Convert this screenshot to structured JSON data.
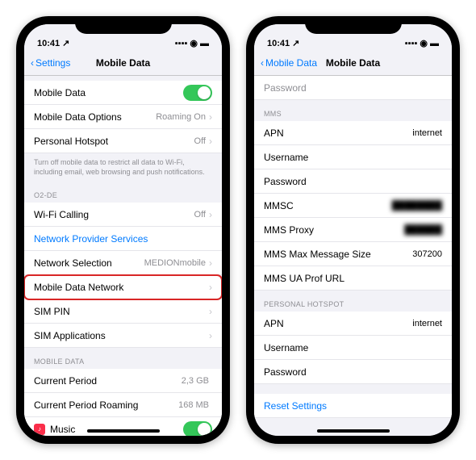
{
  "status": {
    "time": "10:41",
    "loc": "↗"
  },
  "left": {
    "back": "Settings",
    "title": "Mobile Data",
    "cells": {
      "mobile_data": "Mobile Data",
      "options": "Mobile Data Options",
      "options_val": "Roaming On",
      "hotspot": "Personal Hotspot",
      "hotspot_val": "Off",
      "help": "Turn off mobile data to restrict all data to Wi-Fi, including email, web browsing and push notifications.",
      "carrier_group": "O2-DE",
      "wifi_calling": "Wi-Fi Calling",
      "wifi_calling_val": "Off",
      "provider_services": "Network Provider Services",
      "network_selection": "Network Selection",
      "network_selection_val": "MEDIONmobile",
      "mobile_data_network": "Mobile Data Network",
      "sim_pin": "SIM PIN",
      "sim_apps": "SIM Applications",
      "md_group": "MOBILE DATA",
      "current_period": "Current Period",
      "current_period_val": "2,3 GB",
      "roaming": "Current Period Roaming",
      "roaming_val": "168 MB",
      "music": "Music"
    }
  },
  "right": {
    "back": "Mobile Data",
    "title": "Mobile Data",
    "password_partial": "Password",
    "mms_group": "MMS",
    "apn": "APN",
    "apn_val": "internet",
    "username": "Username",
    "password": "Password",
    "mmsc": "MMSC",
    "mms_proxy": "MMS Proxy",
    "mms_max": "MMS Max Message Size",
    "mms_max_val": "307200",
    "mms_ua": "MMS UA Prof URL",
    "ph_group": "PERSONAL HOTSPOT",
    "reset": "Reset Settings"
  }
}
